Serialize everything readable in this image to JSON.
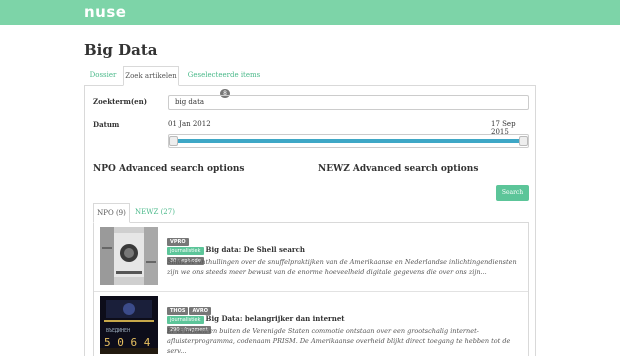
{
  "app": {
    "logo": "nuse",
    "brand_color": "#7dd4a8",
    "accent_color": "#5cc599"
  },
  "page": {
    "title": "Big Data"
  },
  "tabs": [
    {
      "label": "Dossier"
    },
    {
      "label": "Zoek artikelen"
    },
    {
      "label": "Geselecteerde items",
      "badge": "8"
    }
  ],
  "search": {
    "term_label": "Zoekterm(en)",
    "term_value": "big data",
    "date_label": "Datum",
    "date_start": "01 Jan 2012",
    "date_end": "17 Sep 2015",
    "npo_options": "NPO Advanced search options",
    "newz_options": "NEWZ Advanced search options",
    "search_button": "Search"
  },
  "result_tabs": [
    {
      "label": "NPO (9)"
    },
    {
      "label": "NEWZ (27)"
    }
  ],
  "results": [
    {
      "broadcasters": [
        "VPRO"
      ],
      "genre": "journalistiek",
      "title": "Big data: De Shell search",
      "count": "30 : episode",
      "description": "Sinds de onthullingen over de snuffelpraktijken van de Amerikaanse en Nederlandse inlichtingendiensten zijn we ons steeds meer bewust van de enorme hoeveelheid digitale gegevens die over ons zijn...",
      "thumb_icon": "documentary-thumbnail"
    },
    {
      "broadcasters": [
        "THOS",
        "AVRO"
      ],
      "genre": "journalistiek",
      "title": "Big Data: belangrijker dan internet",
      "count": "290 : fragment",
      "description": "Er is binnen en buiten de Verenigde Staten commotie ontstaan over een grootschalig internet-afluisterprogramma, codenaam PRISM. De Amerikaanse overheid blijkt direct toegang te hebben tot de serv...",
      "thumb_icon": "digital-numbers-thumbnail"
    }
  ]
}
